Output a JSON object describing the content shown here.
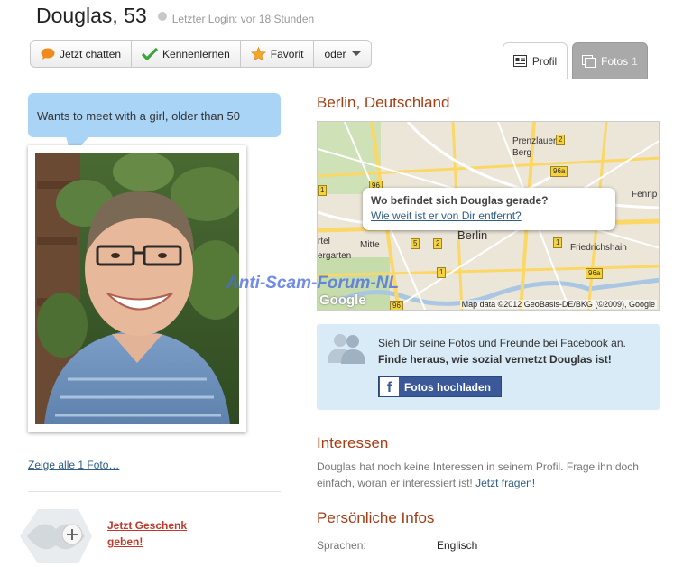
{
  "profile": {
    "name": "Douglas, 53",
    "last_login": "Letzter Login: vor 18 Stunden",
    "status_color": "#c8c8c8"
  },
  "toolbar": {
    "chat_label": "Jetzt chatten",
    "meet_label": "Kennenlernen",
    "favorite_label": "Favorit",
    "more_label": "oder"
  },
  "tabs": {
    "profil_label": "Profil",
    "fotos_label": "Fotos",
    "fotos_count": "1"
  },
  "left": {
    "bubble_text": "Wants to meet with a girl, older than 50",
    "show_all_photos": "Zeige alle 1 Foto…",
    "gift_link_line1": "Jetzt Geschenk",
    "gift_link_line2": "geben!"
  },
  "location": {
    "title": "Berlin, Deutschland",
    "popup_question": "Wo befindet sich Douglas gerade?",
    "popup_link": "Wie weit ist er von Dir entfernt?",
    "attribution": "Map data ©2012 GeoBasis-DE/BKG (©2009), Google",
    "google_logo": "Google",
    "labels": {
      "prenzlauer": "Prenzlauer",
      "berg": "Berg",
      "mitte": "Mitte",
      "berlin": "Berlin",
      "friedrichshain": "Friedrichshain",
      "fennp": "Fennp",
      "rtel": "rtel",
      "ergarten": "ergarten"
    },
    "road_badges": [
      "2",
      "96a",
      "96",
      "5",
      "2",
      "1",
      "1",
      "96a",
      "96",
      "1"
    ]
  },
  "watermark": "Anti-Scam-Forum-NL",
  "facebook": {
    "line1": "Sieh Dir seine Fotos und Freunde bei Facebook an.",
    "line2": "Finde heraus, wie sozial vernetzt Douglas ist!",
    "button_label": "Fotos hochladen",
    "button_color": "#3b5998"
  },
  "interests": {
    "title": "Interessen",
    "text": "Douglas hat noch keine Interessen in seinem Profil. Frage ihn doch einfach, woran er interessiert ist!",
    "link": "Jetzt fragen!"
  },
  "personal": {
    "title": "Persönliche Infos",
    "languages_key": "Sprachen:",
    "languages_value": "Englisch"
  }
}
